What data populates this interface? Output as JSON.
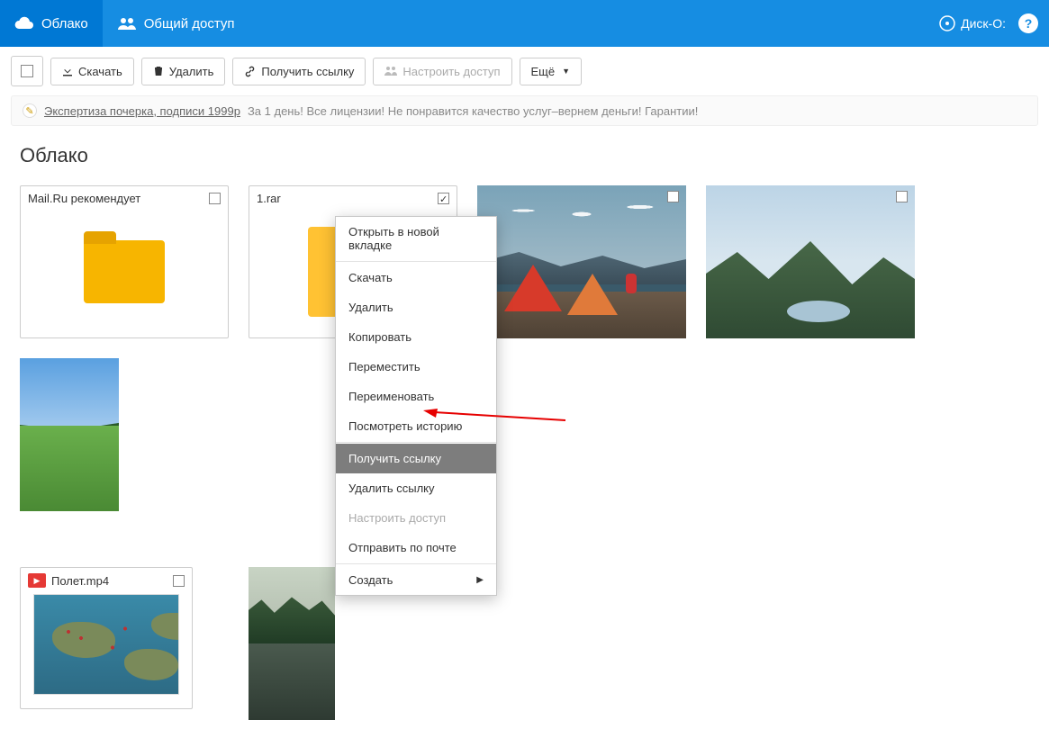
{
  "topnav": {
    "cloud": "Облако",
    "shared": "Общий доступ",
    "disk": "Диск-О:"
  },
  "toolbar": {
    "download": "Скачать",
    "delete": "Удалить",
    "getlink": "Получить ссылку",
    "access": "Настроить доступ",
    "more": "Ещё"
  },
  "ad": {
    "link": "Экспертиза почерка, подписи 1999р",
    "text": "За 1 день! Все лицензии! Не понравится качество услуг–вернем деньги! Гарантии!"
  },
  "page": {
    "title": "Облако"
  },
  "tiles": {
    "recommend": "Mail.Ru рекомендует",
    "rar": "1.rar",
    "video": "Полет.mp4"
  },
  "ctx": {
    "open_tab": "Открыть в новой вкладке",
    "download": "Скачать",
    "delete": "Удалить",
    "copy": "Копировать",
    "move": "Переместить",
    "rename": "Переименовать",
    "history": "Посмотреть историю",
    "getlink": "Получить ссылку",
    "dellink": "Удалить ссылку",
    "access": "Настроить доступ",
    "sendmail": "Отправить по почте",
    "create": "Создать"
  }
}
